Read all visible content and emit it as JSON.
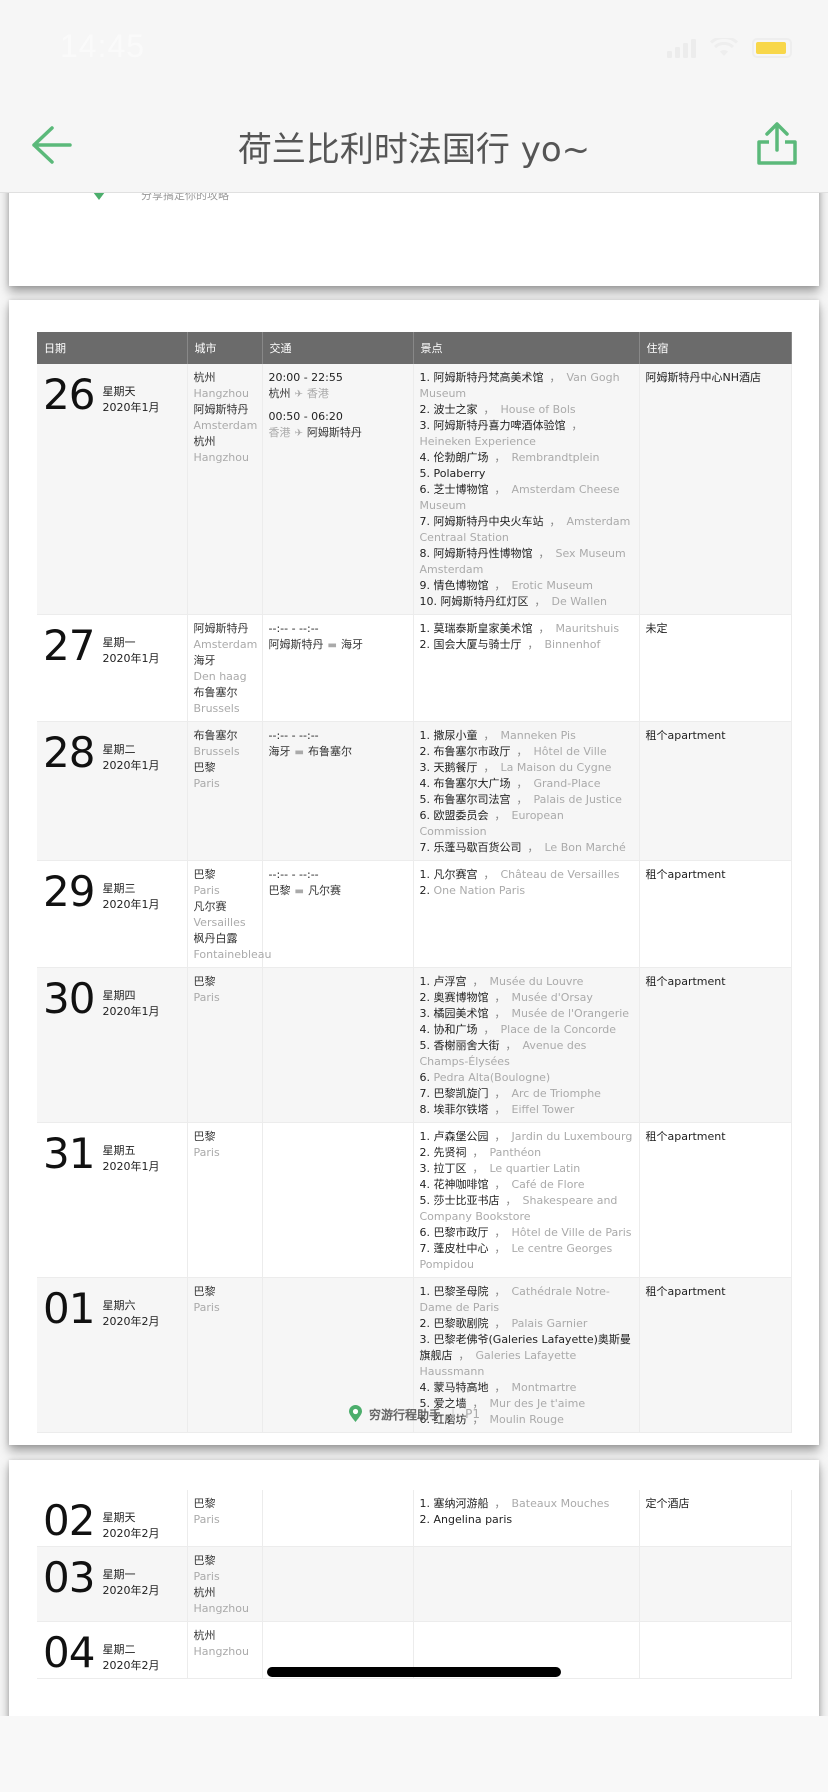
{
  "status_bar": {
    "time": "14:45",
    "battery_color": "#f8d74a"
  },
  "nav": {
    "title": "荷兰比利时法国行 yo~",
    "back_icon": "arrow-left-icon",
    "share_icon": "share-icon",
    "accent": "#5bb97a"
  },
  "page0": {
    "partial_text": "分享搞定你的攻略"
  },
  "table": {
    "headers": [
      "日期",
      "城市",
      "交通",
      "景点",
      "住宿"
    ]
  },
  "pages": [
    {
      "footer": {
        "brand": "穷游行程助手",
        "page": "P1"
      },
      "rows": [
        {
          "day": "26",
          "weekday": "星期天",
          "month": "2020年1月",
          "cities": [
            [
              "杭州",
              "Hangzhou"
            ],
            [
              "阿姆斯特丹",
              "Amsterdam"
            ],
            [
              "杭州",
              "Hangzhou"
            ]
          ],
          "transport": [
            {
              "time": "20:00 - 22:55",
              "from": "杭州",
              "from_muted": false,
              "icon": "plane",
              "to": "香港",
              "to_muted": true
            },
            {
              "time": "00:50 - 06:20",
              "from": "香港",
              "from_muted": true,
              "icon": "plane",
              "to": "阿姆斯特丹",
              "to_muted": false
            }
          ],
          "spots": [
            {
              "n": "1.",
              "cn": "阿姆斯特丹梵高美术馆",
              "en": "Van Gogh Museum"
            },
            {
              "n": "2.",
              "cn": "波士之家",
              "en": "House of Bols"
            },
            {
              "n": "3.",
              "cn": "阿姆斯特丹喜力啤酒体验馆",
              "en": "Heineken Experience"
            },
            {
              "n": "4.",
              "cn": "伦勃朗广场",
              "en": "Rembrandtplein"
            },
            {
              "n": "5.",
              "cn": "Polaberry",
              "en": ""
            },
            {
              "n": "6.",
              "cn": "芝士博物馆",
              "en": "Amsterdam Cheese Museum"
            },
            {
              "n": "7.",
              "cn": "阿姆斯特丹中央火车站",
              "en": "Amsterdam Centraal Station"
            },
            {
              "n": "8.",
              "cn": "阿姆斯特丹性博物馆",
              "en": "Sex Museum Amsterdam"
            },
            {
              "n": "9.",
              "cn": "情色博物馆",
              "en": "Erotic Museum"
            },
            {
              "n": "10.",
              "cn": "阿姆斯特丹红灯区",
              "en": "De Wallen"
            }
          ],
          "stay": "阿姆斯特丹中心NH酒店"
        },
        {
          "day": "27",
          "weekday": "星期一",
          "month": "2020年1月",
          "cities": [
            [
              "阿姆斯特丹",
              "Amsterdam"
            ],
            [
              "海牙",
              "Den haag"
            ],
            [
              "布鲁塞尔",
              "Brussels"
            ]
          ],
          "transport": [
            {
              "time": "--:-- - --:--",
              "from": "阿姆斯特丹",
              "from_muted": false,
              "icon": "car",
              "to": "海牙",
              "to_muted": false
            }
          ],
          "spots": [
            {
              "n": "1.",
              "cn": "莫瑞泰斯皇家美术馆",
              "en": "Mauritshuis"
            },
            {
              "n": "2.",
              "cn": "国会大厦与骑士厅",
              "en": "Binnenhof"
            }
          ],
          "stay": "未定"
        },
        {
          "day": "28",
          "weekday": "星期二",
          "month": "2020年1月",
          "cities": [
            [
              "布鲁塞尔",
              "Brussels"
            ],
            [
              "巴黎",
              "Paris"
            ]
          ],
          "transport": [
            {
              "time": "--:-- - --:--",
              "from": "海牙",
              "from_muted": false,
              "icon": "car",
              "to": "布鲁塞尔",
              "to_muted": false
            }
          ],
          "spots": [
            {
              "n": "1.",
              "cn": "撒尿小童",
              "en": "Manneken Pis"
            },
            {
              "n": "2.",
              "cn": "布鲁塞尔市政厅",
              "en": "Hôtel de Ville"
            },
            {
              "n": "3.",
              "cn": "天鹅餐厅",
              "en": "La Maison du Cygne"
            },
            {
              "n": "4.",
              "cn": "布鲁塞尔大广场",
              "en": "Grand-Place"
            },
            {
              "n": "5.",
              "cn": "布鲁塞尔司法宫",
              "en": "Palais de Justice"
            },
            {
              "n": "6.",
              "cn": "欧盟委员会",
              "en": "European Commission"
            },
            {
              "n": "7.",
              "cn": "乐蓬马歇百货公司",
              "en": "Le Bon Marché"
            }
          ],
          "stay": "租个apartment"
        },
        {
          "day": "29",
          "weekday": "星期三",
          "month": "2020年1月",
          "cities": [
            [
              "巴黎",
              "Paris"
            ],
            [
              "凡尔赛",
              "Versailles"
            ],
            [
              "枫丹白露",
              "Fontainebleau"
            ]
          ],
          "transport": [
            {
              "time": "--:-- - --:--",
              "from": "巴黎",
              "from_muted": false,
              "icon": "car",
              "to": "凡尔赛",
              "to_muted": false
            }
          ],
          "spots": [
            {
              "n": "1.",
              "cn": "凡尔赛宫",
              "en": "Château de Versailles"
            },
            {
              "n": "2.",
              "cn": "",
              "en": "One Nation Paris"
            }
          ],
          "stay": "租个apartment"
        },
        {
          "day": "30",
          "weekday": "星期四",
          "month": "2020年1月",
          "cities": [
            [
              "巴黎",
              "Paris"
            ]
          ],
          "transport": [],
          "spots": [
            {
              "n": "1.",
              "cn": "卢浮宫",
              "en": "Musée du Louvre"
            },
            {
              "n": "2.",
              "cn": "奥赛博物馆",
              "en": "Musée d'Orsay"
            },
            {
              "n": "3.",
              "cn": "橘园美术馆",
              "en": "Musée de l'Orangerie"
            },
            {
              "n": "4.",
              "cn": "协和广场",
              "en": "Place de la Concorde"
            },
            {
              "n": "5.",
              "cn": "香榭丽舍大街",
              "en": "Avenue des Champs-Élysées"
            },
            {
              "n": "6.",
              "cn": "",
              "en": "Pedra Alta(Boulogne)"
            },
            {
              "n": "7.",
              "cn": "巴黎凯旋门",
              "en": "Arc de Triomphe"
            },
            {
              "n": "8.",
              "cn": "埃菲尔铁塔",
              "en": "Eiffel Tower"
            }
          ],
          "stay": "租个apartment"
        },
        {
          "day": "31",
          "weekday": "星期五",
          "month": "2020年1月",
          "cities": [
            [
              "巴黎",
              "Paris"
            ]
          ],
          "transport": [],
          "spots": [
            {
              "n": "1.",
              "cn": "卢森堡公园",
              "en": "Jardin du Luxembourg"
            },
            {
              "n": "2.",
              "cn": "先贤祠",
              "en": "Panthéon"
            },
            {
              "n": "3.",
              "cn": "拉丁区",
              "en": "Le quartier Latin"
            },
            {
              "n": "4.",
              "cn": "花神咖啡馆",
              "en": "Café de Flore"
            },
            {
              "n": "5.",
              "cn": "莎士比亚书店",
              "en": "Shakespeare and Company Bookstore"
            },
            {
              "n": "6.",
              "cn": "巴黎市政厅",
              "en": "Hôtel de Ville de Paris"
            },
            {
              "n": "7.",
              "cn": "蓬皮杜中心",
              "en": "Le centre Georges Pompidou"
            }
          ],
          "stay": "租个apartment"
        },
        {
          "day": "01",
          "weekday": "星期六",
          "month": "2020年2月",
          "cities": [
            [
              "巴黎",
              "Paris"
            ]
          ],
          "transport": [],
          "spots": [
            {
              "n": "1.",
              "cn": "巴黎圣母院",
              "en": "Cathédrale Notre-Dame de Paris"
            },
            {
              "n": "2.",
              "cn": "巴黎歌剧院",
              "en": "Palais Garnier"
            },
            {
              "n": "3.",
              "cn": "巴黎老佛爷(Galeries Lafayette)奥斯曼旗舰店",
              "en": "Galeries Lafayette Haussmann"
            },
            {
              "n": "4.",
              "cn": "蒙马特高地",
              "en": "Montmartre"
            },
            {
              "n": "5.",
              "cn": "爱之墙",
              "en": "Mur des Je t'aime"
            },
            {
              "n": "6.",
              "cn": "红磨坊",
              "en": "Moulin Rouge"
            }
          ],
          "stay": "租个apartment"
        }
      ]
    },
    {
      "rows": [
        {
          "day": "02",
          "weekday": "星期天",
          "month": "2020年2月",
          "cities": [
            [
              "巴黎",
              "Paris"
            ]
          ],
          "transport": [],
          "spots": [
            {
              "n": "1.",
              "cn": "塞纳河游船",
              "en": "Bateaux Mouches"
            },
            {
              "n": "2.",
              "cn": "Angelina paris",
              "en": ""
            }
          ],
          "stay": "定个酒店"
        },
        {
          "day": "03",
          "weekday": "星期一",
          "month": "2020年2月",
          "cities": [
            [
              "巴黎",
              "Paris"
            ],
            [
              "杭州",
              "Hangzhou"
            ]
          ],
          "transport": [],
          "spots": [],
          "stay": ""
        },
        {
          "day": "04",
          "weekday": "星期二",
          "month": "2020年2月",
          "cities": [
            [
              "杭州",
              "Hangzhou"
            ]
          ],
          "transport": [],
          "spots": [],
          "stay": ""
        }
      ]
    }
  ]
}
